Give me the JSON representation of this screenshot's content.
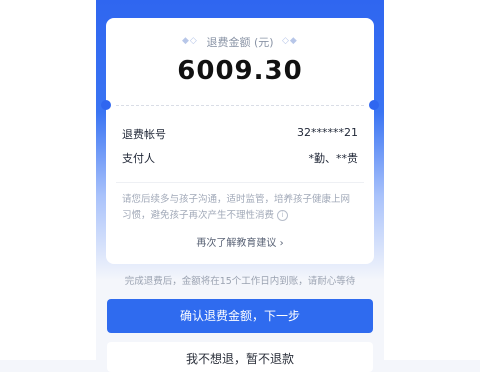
{
  "card": {
    "amount_title": "退费金额 (元)",
    "amount_value": "6009.30",
    "rows": [
      {
        "label": "退费帐号",
        "value": "32******21"
      },
      {
        "label": "支付人",
        "value": "*勤、**贵"
      }
    ],
    "tip": "请您后续多与孩子沟通，适时监管，培养孩子健康上网习惯，避免孩子再次产生不理性消费",
    "learn_link": "再次了解教育建议"
  },
  "note": "完成退费后，金额将在15个工作日内到账，请耐心等待",
  "confirm_button": "确认退费金额，下一步",
  "second_button": "我不想退，暂不退款",
  "icons": {
    "decor": "diamond-icon",
    "info": "info-icon",
    "chevron": "chevron-right-icon"
  },
  "colors": {
    "primary": "#2f6bef"
  }
}
